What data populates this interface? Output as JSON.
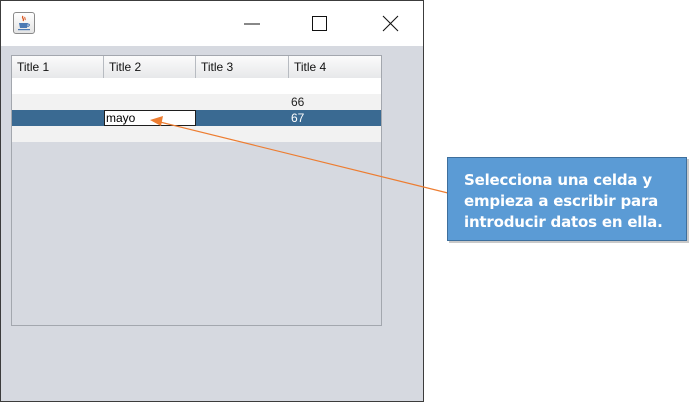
{
  "window": {
    "icon": "java-cup-icon",
    "controls": [
      "minimize-icon",
      "maximize-icon",
      "close-icon"
    ]
  },
  "table": {
    "columns": [
      "Title 1",
      "Title 2",
      "Title 3",
      "Title 4"
    ],
    "rows": [
      [
        "",
        "",
        "",
        ""
      ],
      [
        "",
        "",
        "",
        "66"
      ],
      [
        "",
        "mayo",
        "",
        "67"
      ],
      [
        "",
        "",
        "",
        ""
      ]
    ],
    "selected_row": 2,
    "editing_cell": {
      "row": 2,
      "col": 1
    }
  },
  "callout": {
    "text": "Selecciona una celda y empieza a escribir para introducir datos en ella."
  },
  "colors": {
    "selection": "#3a6a92",
    "callout_fill": "#5b9bd5",
    "arrow": "#ed7d31"
  }
}
